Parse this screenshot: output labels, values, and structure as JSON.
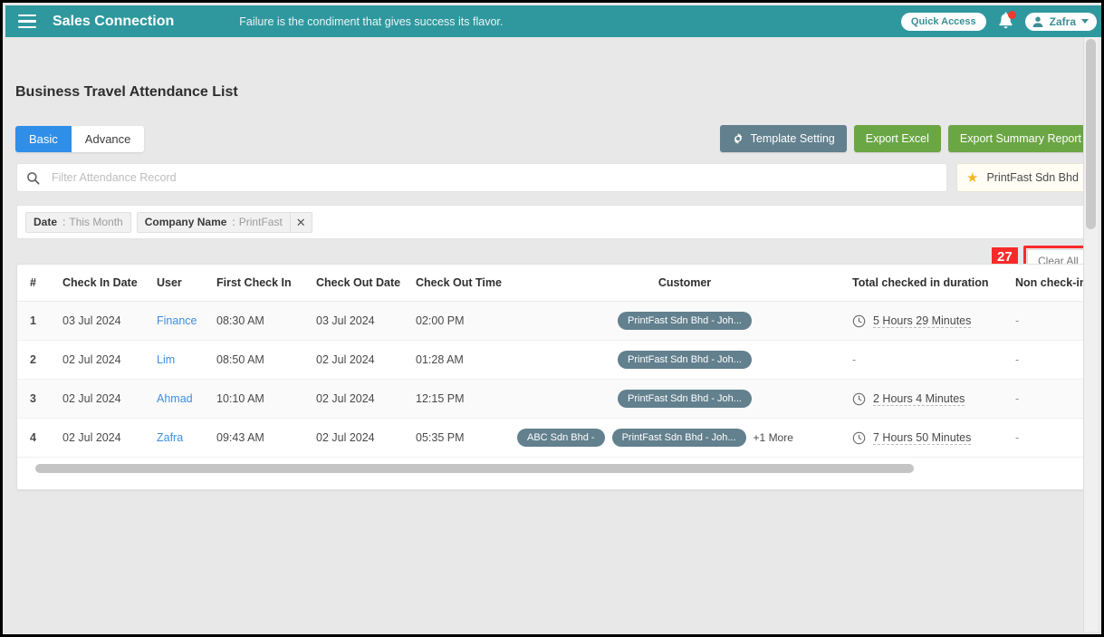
{
  "topbar": {
    "menu_icon": "hamburger-icon",
    "brand": "Sales Connection",
    "tagline": "Failure is the condiment that gives success its flavor.",
    "quick_access": "Quick Access",
    "notification_icon": "bell-icon",
    "user_name": "Zafra",
    "user_icon": "person-icon",
    "caret_icon": "chevron-down-icon",
    "bg_color": "#2f989e"
  },
  "page": {
    "title": "Business Travel Attendance List"
  },
  "tabs": [
    {
      "label": "Basic",
      "active": true
    },
    {
      "label": "Advance",
      "active": false
    }
  ],
  "toolbar": {
    "template_setting": "Template Setting",
    "template_icon": "gear-icon",
    "export_excel": "Export Excel",
    "export_summary": "Export Summary Report",
    "slate_color": "#62808e",
    "green_color": "#6ba644"
  },
  "search": {
    "icon": "search-icon",
    "placeholder": "Filter Attendance Record",
    "value": ""
  },
  "company_selector": {
    "icon": "star-icon",
    "label": "PrintFast Sdn Bhd"
  },
  "filters": {
    "chips": [
      {
        "label": "Date",
        "separator": ":",
        "value": "This Month",
        "closable": false
      },
      {
        "label": "Company Name",
        "separator": ":",
        "value": "PrintFast",
        "closable": true,
        "close_icon": "close-icon"
      }
    ],
    "annotation_badge": "27",
    "clear_all": "Clear All",
    "highlight_color": "#fb2a2a"
  },
  "table": {
    "columns": [
      "#",
      "Check In Date",
      "User",
      "First Check In",
      "Check Out Date",
      "Check Out Time",
      "Customer",
      "Total checked in duration",
      "Non check-in time"
    ],
    "rows": [
      {
        "index": "1",
        "check_in_date": "03 Jul 2024",
        "user": "Finance",
        "first_check_in": "08:30 AM",
        "check_out_date": "03 Jul 2024",
        "check_out_time": "02:00 PM",
        "customers": [
          "PrintFast Sdn Bhd - Joh..."
        ],
        "more": "",
        "duration": "5 Hours 29 Minutes",
        "duration_icon": "clock-icon",
        "non_check_in_time": "-"
      },
      {
        "index": "2",
        "check_in_date": "02 Jul 2024",
        "user": "Lim",
        "first_check_in": "08:50 AM",
        "check_out_date": "02 Jul 2024",
        "check_out_time": "01:28 AM",
        "customers": [
          "PrintFast Sdn Bhd - Joh..."
        ],
        "more": "",
        "duration": "-",
        "duration_icon": "",
        "non_check_in_time": "-"
      },
      {
        "index": "3",
        "check_in_date": "02 Jul 2024",
        "user": "Ahmad",
        "first_check_in": "10:10 AM",
        "check_out_date": "02 Jul 2024",
        "check_out_time": "12:15 PM",
        "customers": [
          "PrintFast Sdn Bhd - Joh..."
        ],
        "more": "",
        "duration": "2 Hours 4 Minutes",
        "duration_icon": "clock-icon",
        "non_check_in_time": "-"
      },
      {
        "index": "4",
        "check_in_date": "02 Jul 2024",
        "user": "Zafra",
        "first_check_in": "09:43 AM",
        "check_out_date": "02 Jul 2024",
        "check_out_time": "05:35 PM",
        "customers": [
          "ABC Sdn Bhd -",
          "PrintFast Sdn Bhd - Joh..."
        ],
        "more": "+1 More",
        "duration": "7 Hours 50 Minutes",
        "duration_icon": "clock-icon",
        "non_check_in_time": "-"
      }
    ],
    "pill_color": "#62808e",
    "link_color": "#3e8ede"
  }
}
